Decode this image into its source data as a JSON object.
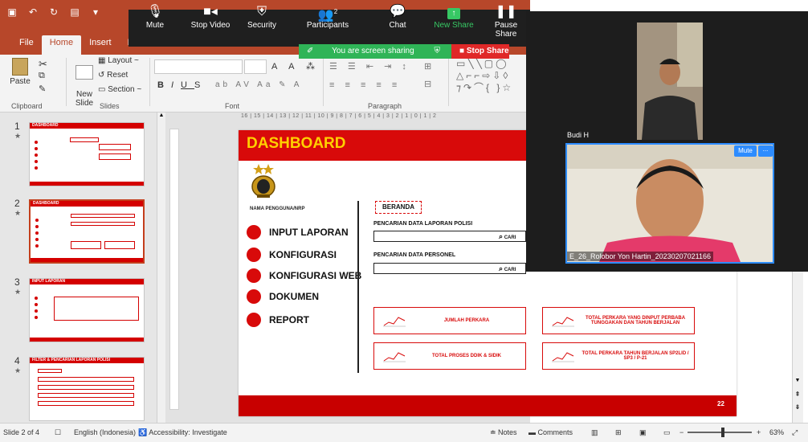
{
  "ppt": {
    "tabs": [
      "File",
      "Home",
      "Insert",
      "D"
    ],
    "active_tab": "Home",
    "ribbon": {
      "paste": "Paste",
      "new_slide": "New\nSlide",
      "layout": "Layout ~",
      "reset": "Reset",
      "section": "Section ~",
      "groups": [
        "Clipboard",
        "Slides",
        "Font",
        "Paragraph"
      ]
    },
    "ruler_text": "16 | 15 | 14 | 13 | 12 | 11 | 10 | 9 | 8 | 7 | 6 | 5 | 4 | 3 | 2 | 1 | 0 | 1 | 2",
    "thumbnails": [
      {
        "num": "1",
        "title": "DASHBOARD"
      },
      {
        "num": "2",
        "title": "DASHBOARD"
      },
      {
        "num": "3",
        "title": "INPUT LAPORAN"
      },
      {
        "num": "4",
        "title": "FILTER & PENCARIAN LAPORAN POLISI"
      }
    ],
    "slide": {
      "title": "DASHBOARD",
      "user_label": "NAMA PENGGUNA/NRP",
      "menu": [
        "INPUT LAPORAN",
        "KONFIGURASI",
        "KONFIGURASI WEB",
        "DOKUMEN",
        "REPORT"
      ],
      "beranda": "BERANDA",
      "search1_label": "PENCARIAN DATA LAPORAN POLISI",
      "search2_label": "PENCARIAN DATA PERSONEL",
      "cari": "CARI",
      "cards": [
        "JUMLAH PERKARA",
        "TOTAL PERKARA YANG DINPUT PERBABA TUNGGAKAN DAN TAHUN BERJALAN",
        "TOTAL PROSES DDIK & SIDIK",
        "TOTAL PERKARA TAHUN BERJALAN SP2LID / SP3 / P-21"
      ],
      "footer_num": "22"
    },
    "status": {
      "slide_info": "Slide 2 of 4",
      "language": "English (Indonesia)",
      "accessibility": "Accessibility: Investigate",
      "notes": "Notes",
      "comments": "Comments",
      "zoom": "63%"
    }
  },
  "zoom": {
    "toolbar": [
      {
        "label": "Mute",
        "icon": "microphone-icon"
      },
      {
        "label": "Stop Video",
        "icon": "video-camera-icon"
      },
      {
        "label": "Security",
        "icon": "shield-icon"
      },
      {
        "label": "Participants",
        "icon": "participants-icon",
        "count": "2"
      },
      {
        "label": "Chat",
        "icon": "chat-icon"
      },
      {
        "label": "New Share",
        "icon": "share-icon"
      },
      {
        "label": "Pause Share",
        "icon": "pause-icon"
      }
    ],
    "sharing_text": "You are screen sharing",
    "stop_share": "Stop Share",
    "participants": [
      {
        "name": "Budi H"
      },
      {
        "name": "E_26_Rolobor Yon Hartin_20230207021166",
        "mute_btn": "Mute",
        "more": "..."
      }
    ]
  },
  "colors": {
    "ppt_accent": "#b7472a",
    "slide_red": "#d80a0a",
    "title_yellow": "#ffd000",
    "zoom_green": "#2fb457",
    "zoom_red": "#e02828",
    "zoom_blue": "#2d8cff"
  }
}
